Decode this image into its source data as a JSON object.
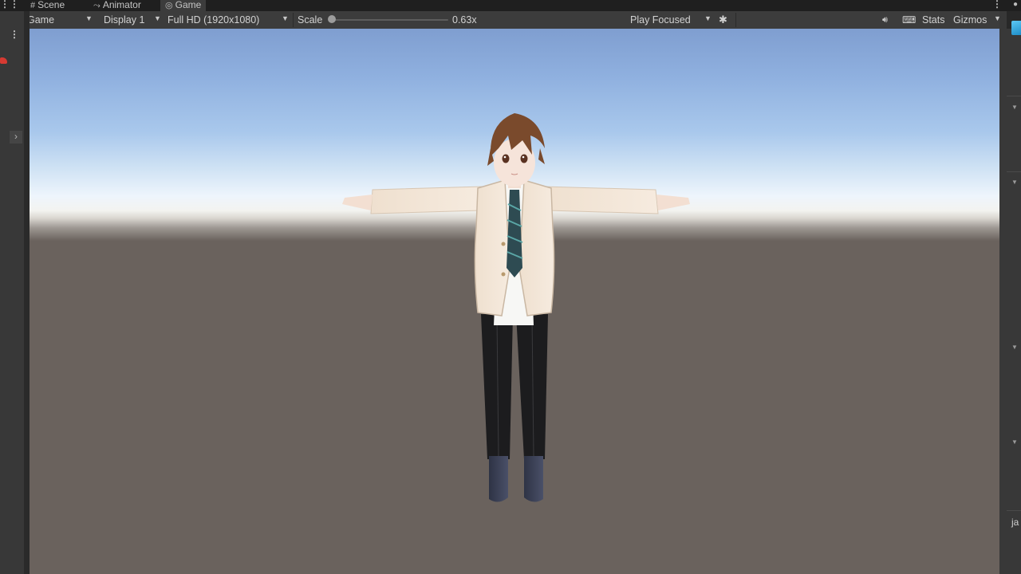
{
  "tabs": [
    {
      "label": "Scene",
      "icon": "grid-icon"
    },
    {
      "label": "Animator",
      "icon": "animator-icon"
    },
    {
      "label": "Game",
      "icon": "gamepad-icon"
    }
  ],
  "toolbar": {
    "view_mode": "Game",
    "display": "Display 1",
    "resolution": "Full HD (1920x1080)",
    "scale_label": "Scale",
    "scale_value": "0.63x",
    "play_mode": "Play Focused",
    "stats_label": "Stats",
    "gizmos_label": "Gizmos"
  },
  "right_panel": {
    "label": "ja"
  },
  "colors": {
    "editor_bg": "#282828",
    "toolbar_bg": "#3c3c3c",
    "sky_top": "#7f9ed0",
    "horizon": "#eef5fc",
    "ground": "#6a625d"
  }
}
